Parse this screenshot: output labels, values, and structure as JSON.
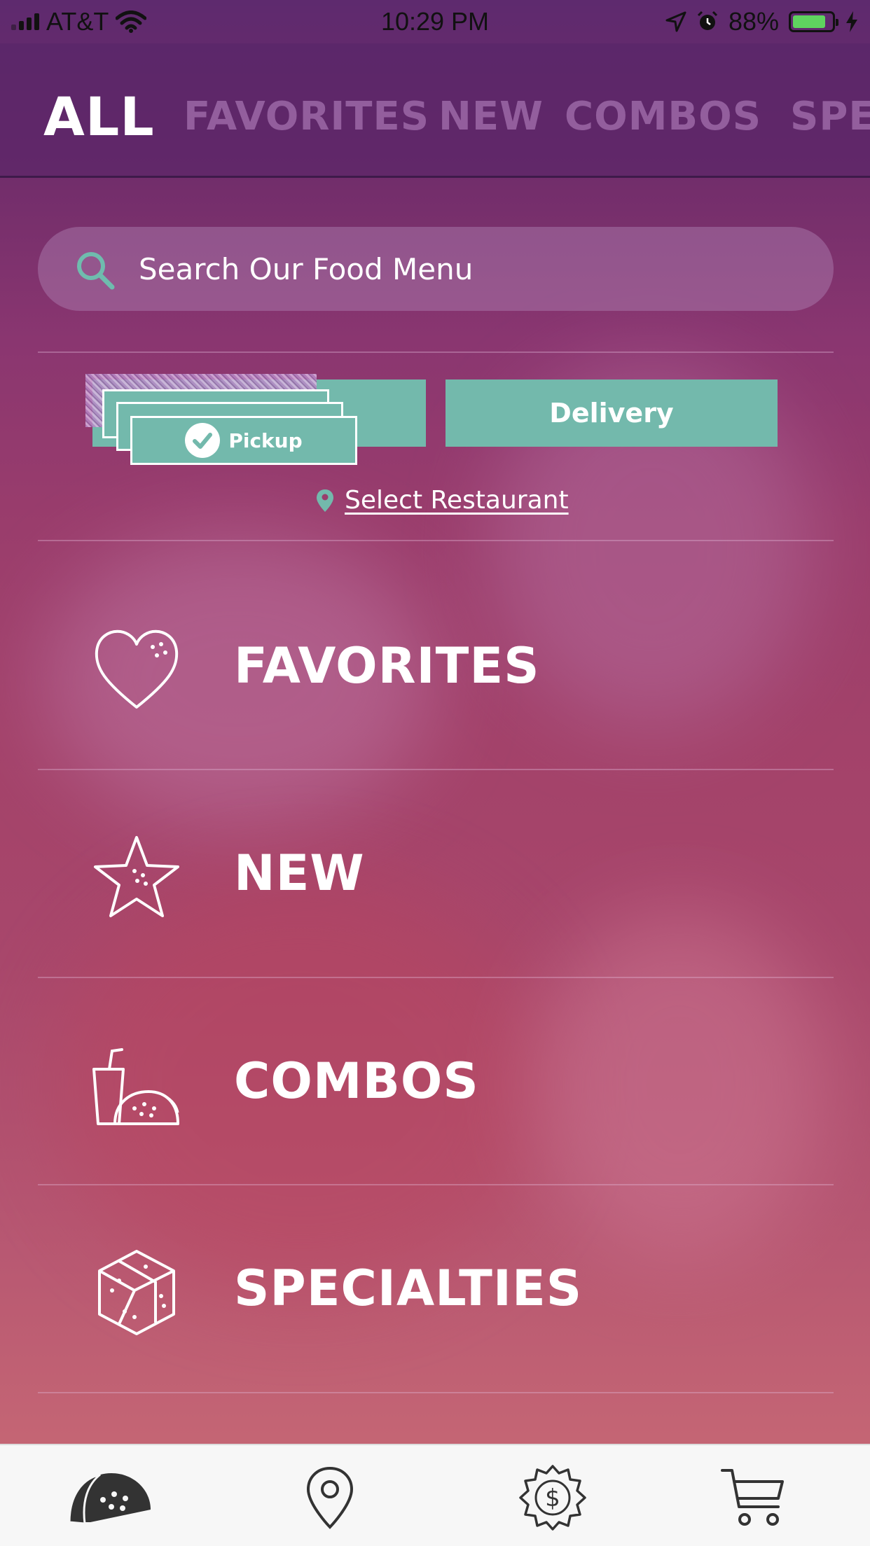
{
  "status_bar": {
    "carrier": "AT&T",
    "time": "10:29 PM",
    "battery": "88%",
    "battery_level": 0.88
  },
  "tabs": [
    {
      "label": "ALL",
      "active": true
    },
    {
      "label": "FAVORITES",
      "active": false
    },
    {
      "label": "NEW",
      "active": false
    },
    {
      "label": "COMBOS",
      "active": false
    },
    {
      "label": "SPECIALTIES",
      "active": false
    }
  ],
  "search": {
    "placeholder": "Search Our Food Menu",
    "icon": "search-icon"
  },
  "order_mode": {
    "pickup_label": "Pickup",
    "delivery_label": "Delivery",
    "selected": "Pickup",
    "select_restaurant": "Select Restaurant"
  },
  "categories": [
    {
      "label": "FAVORITES",
      "icon": "heart-icon"
    },
    {
      "label": "NEW",
      "icon": "star-icon"
    },
    {
      "label": "COMBOS",
      "icon": "drink-taco-icon"
    },
    {
      "label": "SPECIALTIES",
      "icon": "box-icon"
    }
  ],
  "bottom_nav": [
    {
      "name": "menu",
      "icon": "taco-icon"
    },
    {
      "name": "locations",
      "icon": "location-pin-icon"
    },
    {
      "name": "rewards",
      "icon": "dollar-badge-icon"
    },
    {
      "name": "cart",
      "icon": "cart-icon"
    }
  ],
  "colors": {
    "accent": "#73b9ac",
    "header": "#5e2a6e",
    "background_bottom": "#c96a76",
    "nav_bg": "#f7f7f7"
  }
}
